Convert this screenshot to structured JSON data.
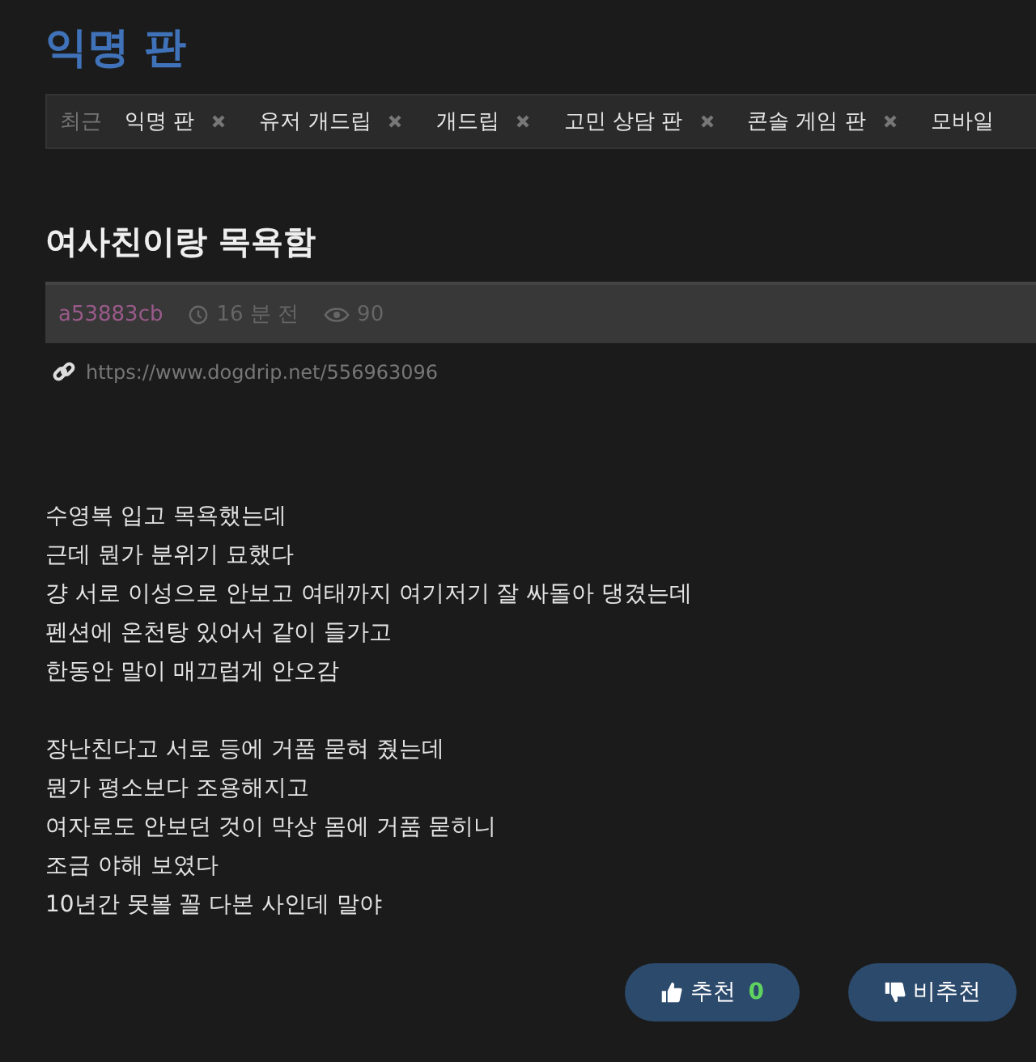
{
  "board_title": "익명 판",
  "recent": {
    "label": "최근",
    "tabs": [
      {
        "label": "익명 판"
      },
      {
        "label": "유저 개드립"
      },
      {
        "label": "개드립"
      },
      {
        "label": "고민 상담 판"
      },
      {
        "label": "콘솔 게임 판"
      },
      {
        "label": "모바일"
      }
    ]
  },
  "post": {
    "title": "여사친이랑 목욕함",
    "author": "a53883cb",
    "time": "16 분 전",
    "views": "90",
    "url": "https://www.dogdrip.net/556963096",
    "paragraphs": [
      [
        "수영복 입고 목욕했는데",
        "근데 뭔가 분위기 묘했다",
        "걍 서로 이성으로 안보고 여태까지 여기저기 잘 싸돌아 댕겼는데",
        "펜션에 온천탕 있어서 같이 들가고",
        "한동안 말이 매끄럽게 안오감"
      ],
      [
        "장난친다고 서로 등에 거품 묻혀 줬는데",
        "뭔가 평소보다 조용해지고",
        "여자로도 안보던 것이 막상 몸에 거품 묻히니",
        "조금 야해 보였다",
        "10년간 못볼 꼴 다본 사인데 말야"
      ]
    ]
  },
  "vote": {
    "up_label": "추천",
    "up_count": "0",
    "down_label": "비추천"
  }
}
